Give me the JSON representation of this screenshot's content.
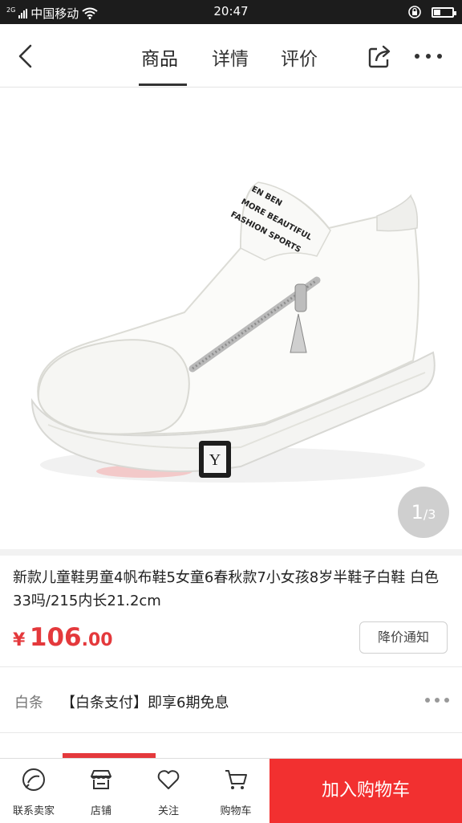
{
  "status_bar": {
    "network_type": "2G",
    "carrier": "中国移动",
    "time": "20:47"
  },
  "nav": {
    "tabs": [
      {
        "label": "商品",
        "active": true
      },
      {
        "label": "详情",
        "active": false
      },
      {
        "label": "评价",
        "active": false
      }
    ],
    "icons": {
      "back": "chevron-left-icon",
      "share": "share-icon",
      "more": "more-horizontal-icon"
    }
  },
  "product": {
    "image_text": {
      "line1": "EN BEN",
      "line2": "MORE BEAUTIFUL",
      "line3": "FASHION SPORTS"
    },
    "image_counter": {
      "current": "1",
      "total": "/3"
    },
    "title": "新款儿童鞋男童4帆布鞋5女童6春秋款7小女孩8岁半鞋子白鞋 白色 33吗/215内长21.2cm",
    "price": {
      "symbol": "¥",
      "integer": "106",
      "decimal": ".00"
    },
    "notify_button": "降价通知"
  },
  "baitiao": {
    "label": "白条",
    "text": "【白条支付】即享6期免息"
  },
  "bottom_bar": {
    "items": [
      {
        "label": "联系卖家",
        "icon": "chat-icon"
      },
      {
        "label": "店铺",
        "icon": "store-icon"
      },
      {
        "label": "关注",
        "icon": "heart-icon"
      },
      {
        "label": "购物车",
        "icon": "cart-icon"
      }
    ],
    "add_to_cart": "加入购物车"
  },
  "colors": {
    "accent": "#f23030",
    "price": "#e4393c",
    "status_bar": "#1c1c1c"
  }
}
